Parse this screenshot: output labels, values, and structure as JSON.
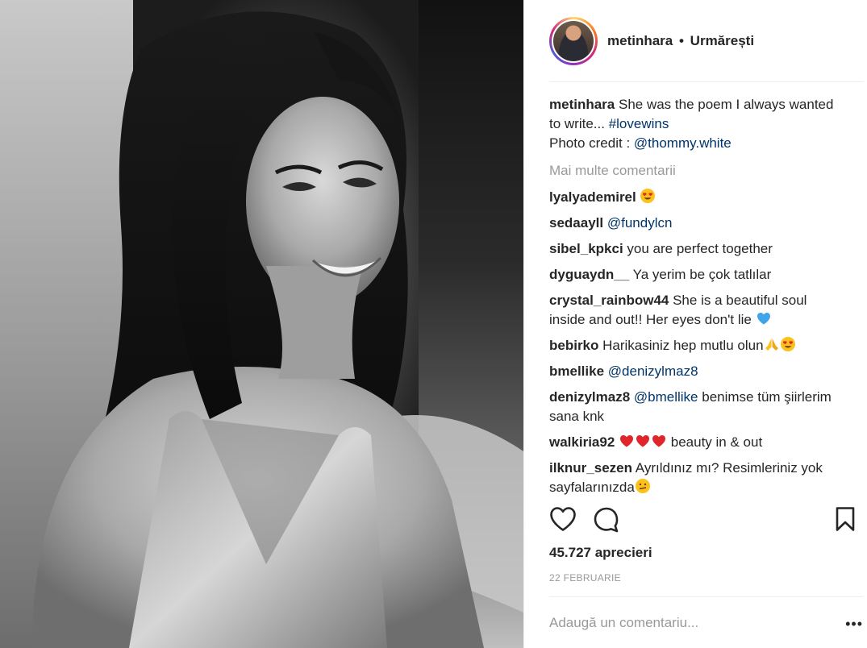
{
  "post": {
    "image_alt": "",
    "watermark": "",
    "header": {
      "username": "metinhara",
      "separator": "•",
      "follow_status": "Urmărești"
    },
    "caption": {
      "username": "metinhara",
      "text_1": "She was the poem I always wanted to write... ",
      "hashtag": "#lovewins",
      "text_2": "Photo credit : ",
      "mention": "@thommy.white"
    },
    "more_comments": "Mai multe comentarii",
    "comments": [
      {
        "user": "lyalyademirel",
        "text": "",
        "emoji": "heart-eyes"
      },
      {
        "user": "sedaayll",
        "mention": "@fundylcn",
        "text": ""
      },
      {
        "user": "sibel_kpkci",
        "text": "you are perfect together"
      },
      {
        "user": "dyguaydn__",
        "text": "Ya yerim be çok tatlılar"
      },
      {
        "user": "crystal_rainbow44",
        "text": "She is a beautiful soul inside and out!! Her eyes don't lie",
        "emoji": "blue-heart"
      },
      {
        "user": "bebirko",
        "text": "Harikasiniz hep mutlu olun",
        "emoji": "pray-heart-eyes"
      },
      {
        "user": "bmellike",
        "mention": "@denizylmaz8",
        "text": ""
      },
      {
        "user": "denizylmaz8",
        "mention": "@bmellike",
        "text": "benimse tüm şiirlerim sana knk"
      },
      {
        "user": "walkiria92",
        "text": "beauty in & out",
        "emoji": "three-red-hearts"
      },
      {
        "user": "ilknur_sezen",
        "text": "Ayrıldınız mı? Resimleriniz yok sayfalarınızda",
        "emoji": "confused"
      }
    ],
    "likes": "45.727 aprecieri",
    "date": "22 FEBRUARIE",
    "add_comment_placeholder": "Adaugă un comentariu...",
    "more_options": "•••"
  },
  "colors": {
    "link": "#003569",
    "muted": "#999999",
    "text": "#262626",
    "divider": "#efefef"
  }
}
